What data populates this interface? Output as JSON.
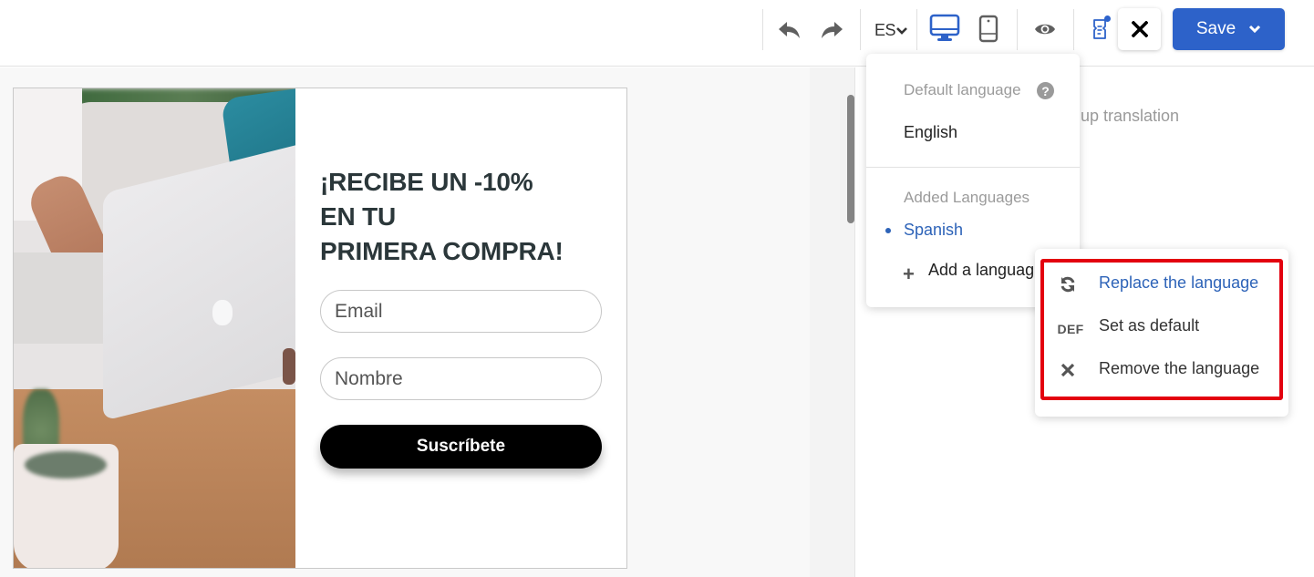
{
  "toolbar": {
    "undo_icon": "undo-arrow",
    "redo_icon": "redo-arrow",
    "language_code": "ES",
    "desktop_icon": "desktop-monitor",
    "mobile_icon": "mobile-phone",
    "preview_icon": "eye",
    "notes_icon": "document-with-badge",
    "close_icon": "x",
    "save_label": "Save",
    "accent_color": "#2d62c9"
  },
  "right_panel": {
    "visible_text": "up translation"
  },
  "popup_preview": {
    "headline_lines": [
      "¡RECIBE UN -10%",
      "EN TU",
      "PRIMERA COMPRA!"
    ],
    "email_placeholder": "Email",
    "name_placeholder": "Nombre",
    "cta_label": "Suscríbete"
  },
  "language_menu": {
    "default_section_label": "Default language",
    "default_language": "English",
    "added_section_label": "Added Languages",
    "added_languages": [
      "Spanish"
    ],
    "add_language_label": "Add a languag"
  },
  "language_context_menu": {
    "items": [
      {
        "icon": "refresh",
        "label": "Replace the language"
      },
      {
        "icon": "DEF",
        "label": "Set as default"
      },
      {
        "icon": "x",
        "label": "Remove the language"
      }
    ],
    "highlight_color": "#e3000f"
  }
}
